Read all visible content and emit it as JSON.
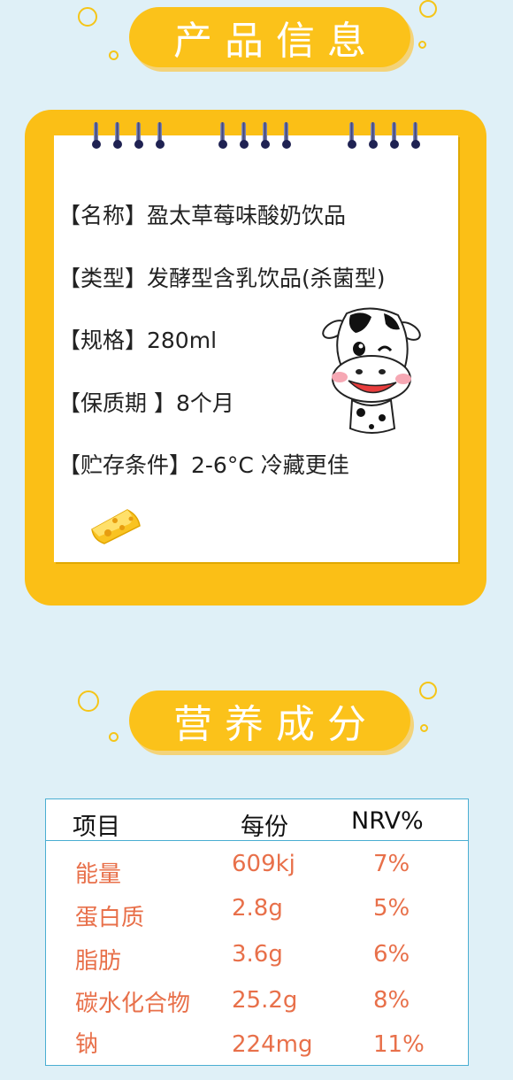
{
  "sections": {
    "product_title": "产品信息",
    "nutrition_title": "营养成分"
  },
  "product_info": [
    {
      "text": "【名称】盈太草莓味酸奶饮品"
    },
    {
      "text": "【类型】发酵型含乳饮品(杀菌型)"
    },
    {
      "text": "【规格】280ml"
    },
    {
      "text": "【保质期 】8个月"
    },
    {
      "text": "【贮存条件】2-6°C 冷藏更佳"
    }
  ],
  "nutrition": {
    "headers": [
      "项目",
      "每份",
      "NRV%"
    ],
    "rows": [
      [
        "能量",
        "609kj",
        "7%"
      ],
      [
        "蛋白质",
        "2.8g",
        "5%"
      ],
      [
        "脂肪",
        "3.6g",
        "6%"
      ],
      [
        "碳水化合物",
        "25.2g",
        "8%"
      ],
      [
        "钠",
        "224mg",
        "11%"
      ]
    ]
  },
  "colors": {
    "background": "#dff0f7",
    "accent_yellow": "#fbc21a",
    "table_border": "#4aaed2",
    "value_orange": "#e8704a"
  },
  "icons": [
    "cow-mascot-icon",
    "cheese-icon",
    "spiral-binding-icon"
  ]
}
